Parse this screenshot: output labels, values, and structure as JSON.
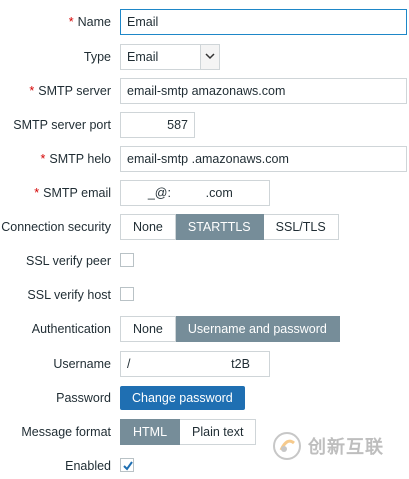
{
  "fields": {
    "name": {
      "label": "Name",
      "value": "Email"
    },
    "type": {
      "label": "Type",
      "value": "Email"
    },
    "smtp_server": {
      "label": "SMTP server",
      "value": "email-smtp                    amazonaws.com"
    },
    "smtp_port": {
      "label": "SMTP server port",
      "value": "587"
    },
    "smtp_helo": {
      "label": "SMTP helo",
      "value": "email-smtp                   .amazonaws.com"
    },
    "smtp_email": {
      "label": "SMTP email",
      "value": "      _@:          .com"
    },
    "connection_security": {
      "label": "Connection security",
      "options": [
        "None",
        "STARTTLS",
        "SSL/TLS"
      ],
      "selected": "STARTTLS"
    },
    "ssl_verify_peer": {
      "label": "SSL verify peer",
      "checked": false
    },
    "ssl_verify_host": {
      "label": "SSL verify host",
      "checked": false
    },
    "authentication": {
      "label": "Authentication",
      "options": [
        "None",
        "Username and password"
      ],
      "selected": "Username and password"
    },
    "username": {
      "label": "Username",
      "value": "/                             t2B"
    },
    "password": {
      "label": "Password",
      "button": "Change password"
    },
    "message_format": {
      "label": "Message format",
      "options": [
        "HTML",
        "Plain text"
      ],
      "selected": "HTML"
    },
    "enabled": {
      "label": "Enabled",
      "checked": true
    }
  },
  "required_marker": "*",
  "watermark": {
    "text": "创新互联"
  },
  "colors": {
    "accent": "#1f6fb2",
    "segment_active": "#768d99",
    "required": "#d40000",
    "border": "#cfd5d8"
  }
}
